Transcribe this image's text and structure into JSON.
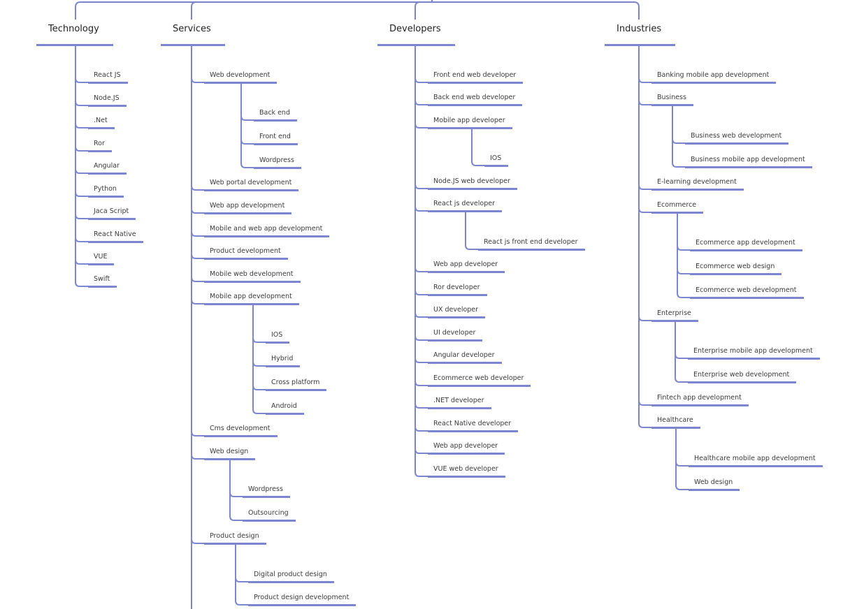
{
  "colors": {
    "line": "#7b86cf",
    "text": "#3a3a3a"
  },
  "mindmap": [
    {
      "label": "Technology",
      "children": [
        {
          "label": "React JS"
        },
        {
          "label": "Node.JS"
        },
        {
          "label": ".Net"
        },
        {
          "label": "Ror"
        },
        {
          "label": "Angular"
        },
        {
          "label": "Python"
        },
        {
          "label": "Jaca Script"
        },
        {
          "label": "React Native"
        },
        {
          "label": "VUE"
        },
        {
          "label": "Swift"
        }
      ]
    },
    {
      "label": "Services",
      "children": [
        {
          "label": "Web development",
          "children": [
            {
              "label": "Back end"
            },
            {
              "label": "Front end"
            },
            {
              "label": "Wordpress"
            }
          ]
        },
        {
          "label": "Web portal development"
        },
        {
          "label": "Web app development"
        },
        {
          "label": "Mobile and web app development"
        },
        {
          "label": "Product development"
        },
        {
          "label": "Mobile web development"
        },
        {
          "label": "Mobile app development",
          "children": [
            {
              "label": "IOS"
            },
            {
              "label": "Hybrid"
            },
            {
              "label": "Cross platform"
            },
            {
              "label": "Android"
            }
          ]
        },
        {
          "label": "Cms development"
        },
        {
          "label": "Web design",
          "children": [
            {
              "label": "Wordpress"
            },
            {
              "label": "Outsourcing"
            }
          ]
        },
        {
          "label": "Product design",
          "children": [
            {
              "label": "Digital product design"
            },
            {
              "label": "Product design development"
            }
          ]
        }
      ]
    },
    {
      "label": "Developers",
      "children": [
        {
          "label": "Front end web developer"
        },
        {
          "label": "Back end web developer"
        },
        {
          "label": "Mobile app developer",
          "children": [
            {
              "label": "IOS"
            }
          ]
        },
        {
          "label": "Node.JS web developer"
        },
        {
          "label": "React js developer",
          "children": [
            {
              "label": "React js front end developer"
            }
          ]
        },
        {
          "label": "Web app developer"
        },
        {
          "label": "Ror developer"
        },
        {
          "label": "UX developer"
        },
        {
          "label": "UI developer"
        },
        {
          "label": "Angular developer"
        },
        {
          "label": "Ecommerce web developer"
        },
        {
          "label": ".NET developer"
        },
        {
          "label": "React Native developer"
        },
        {
          "label": "Web app developer"
        },
        {
          "label": "VUE web developer"
        }
      ]
    },
    {
      "label": "Industries",
      "children": [
        {
          "label": "Banking mobile app development"
        },
        {
          "label": "Business",
          "children": [
            {
              "label": "Business  web development"
            },
            {
              "label": "Business mobile app development"
            }
          ]
        },
        {
          "label": "E-learning development"
        },
        {
          "label": "Ecommerce",
          "children": [
            {
              "label": "Ecommerce  app development"
            },
            {
              "label": "Ecommerce web design"
            },
            {
              "label": "Ecommerce web development"
            }
          ]
        },
        {
          "label": "Enterprise",
          "children": [
            {
              "label": "Enterprise mobile app development"
            },
            {
              "label": "Enterprise web development"
            }
          ]
        },
        {
          "label": "Fintech app development"
        },
        {
          "label": "Healthcare",
          "children": [
            {
              "label": "Healthcare mobile app development"
            },
            {
              "label": "Web design"
            }
          ]
        }
      ]
    }
  ]
}
